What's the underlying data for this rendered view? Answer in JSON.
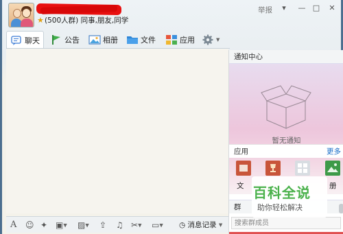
{
  "header": {
    "group_desc": "(500人群) 同事,朋友,同学",
    "report_label": "举报",
    "min_label": "—",
    "max_label": "□",
    "close_label": "✕"
  },
  "tabs": [
    {
      "label": "聊天",
      "icon": "chat-icon"
    },
    {
      "label": "公告",
      "icon": "flag-icon"
    },
    {
      "label": "相册",
      "icon": "photo-icon"
    },
    {
      "label": "文件",
      "icon": "folder-icon"
    },
    {
      "label": "应用",
      "icon": "apps-icon"
    },
    {
      "label": "",
      "icon": "gear-icon"
    }
  ],
  "right_panel": {
    "notice_title": "通知中心",
    "no_notice": "暂无通知",
    "apps_title": "应用",
    "more_label": "更多",
    "apps": [
      {
        "label": "文",
        "icon": "file-app-icon",
        "color": "#c8553a"
      },
      {
        "label": "",
        "icon": "trophy-app-icon",
        "color": "#c8553a"
      },
      {
        "label": "",
        "icon": "grid-app-icon",
        "color": "#d8dde2"
      },
      {
        "label": "册",
        "icon": "album-app-icon",
        "color": "#3d9a48"
      }
    ],
    "members_label": "群",
    "search_placeholder": "搜索群成员"
  },
  "toolbar": {
    "history_label": "消息记录",
    "icons": [
      "font-icon",
      "emoji-icon",
      "magic-icon",
      "rich-message-icon",
      "image-icon",
      "upload-icon",
      "music-icon",
      "screenshot-icon",
      "shake-icon"
    ]
  },
  "watermark": {
    "title": "百科全说",
    "subtitle": "助你轻松解决"
  },
  "colors": {
    "accent_blue": "#1a6fc8",
    "redaction_red": "#e81010",
    "watermark_green": "#4ab14b"
  }
}
